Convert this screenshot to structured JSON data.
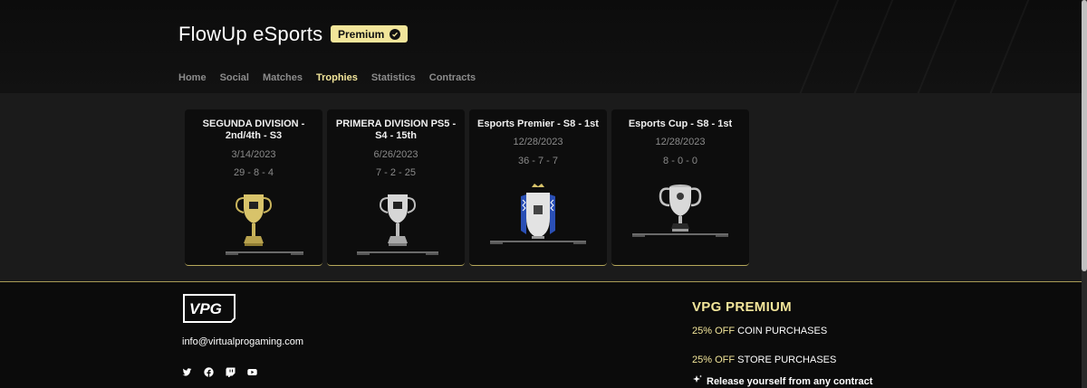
{
  "header": {
    "team_name": "FlowUp eSports",
    "badge_label": "Premium"
  },
  "nav": {
    "tabs": [
      {
        "label": "Home",
        "active": false
      },
      {
        "label": "Social",
        "active": false
      },
      {
        "label": "Matches",
        "active": false
      },
      {
        "label": "Trophies",
        "active": true
      },
      {
        "label": "Statistics",
        "active": false
      },
      {
        "label": "Contracts",
        "active": false
      }
    ]
  },
  "trophies": [
    {
      "name": "SEGUNDA DIVISION - 2nd/4th - S3",
      "date": "3/14/2023",
      "record": "29 - 8 - 4",
      "icon": "gold-cup-icon"
    },
    {
      "name": "PRIMERA DIVISION PS5 - S4 - 15th",
      "date": "6/26/2023",
      "record": "7 - 2 - 25",
      "icon": "silver-cup-icon"
    },
    {
      "name": "Esports Premier - S8 - 1st",
      "date": "12/28/2023",
      "record": "36 - 7 - 7",
      "icon": "premier-trophy-icon"
    },
    {
      "name": "Esports Cup - S8 - 1st",
      "date": "12/28/2023",
      "record": "8 - 0 - 0",
      "icon": "champions-cup-icon"
    }
  ],
  "footer": {
    "logo_text": "VPG",
    "email": "info@virtualprogaming.com",
    "socials": [
      "twitter-icon",
      "facebook-icon",
      "twitch-icon",
      "youtube-icon"
    ],
    "premium_title": "VPG PREMIUM",
    "perk1_highlight": "25% OFF",
    "perk1_rest": " COIN PURCHASES",
    "perk2_highlight": "25% OFF",
    "perk2_rest": " STORE PURCHASES",
    "perk3": "Release yourself from any contract"
  },
  "colors": {
    "accent": "#f2e59a",
    "card_border": "#b7a85a",
    "muted_text": "#8a8a8a"
  }
}
